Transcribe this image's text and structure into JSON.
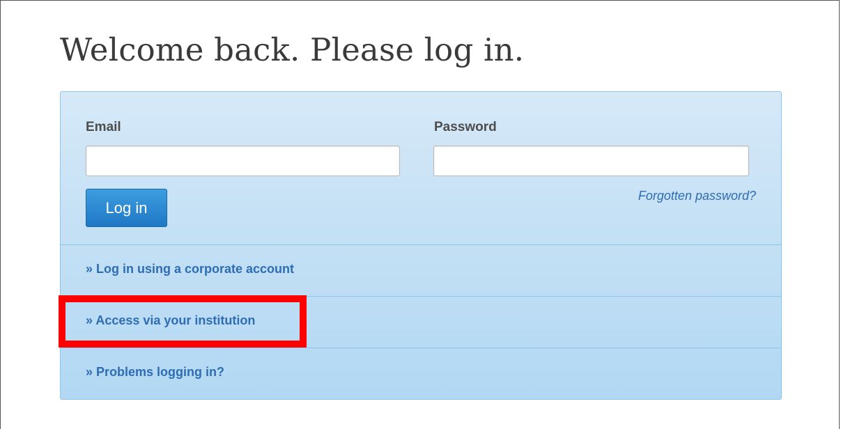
{
  "page": {
    "title": "Welcome back. Please log in."
  },
  "login_form": {
    "email_label": "Email",
    "email_value": "",
    "password_label": "Password",
    "password_value": "",
    "login_button_label": "Log in",
    "forgot_password_label": "Forgotten password?"
  },
  "options": {
    "corporate_label": "» Log in using a corporate account",
    "institution_label": "» Access via your institution",
    "problems_label": "» Problems logging in?"
  },
  "colors": {
    "panel_background": "#c6e1f5",
    "link": "#2f6db3",
    "button": "#1f78c4",
    "highlight": "#ff0000"
  }
}
